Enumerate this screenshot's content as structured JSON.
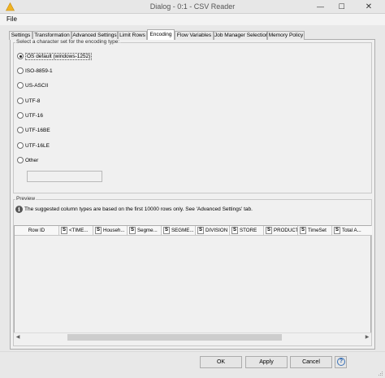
{
  "window": {
    "title": "Dialog - 0:1 - CSV Reader",
    "minimize_glyph": "—",
    "maximize_glyph": "☐",
    "close_glyph": "✕"
  },
  "menu": {
    "file": "File"
  },
  "tabs": [
    {
      "label": "Settings",
      "active": false
    },
    {
      "label": "Transformation",
      "active": false
    },
    {
      "label": "Advanced Settings",
      "active": false
    },
    {
      "label": "Limit Rows",
      "active": false
    },
    {
      "label": "Encoding",
      "active": true
    },
    {
      "label": "Flow Variables",
      "active": false
    },
    {
      "label": "Job Manager Selection",
      "active": false
    },
    {
      "label": "Memory Policy",
      "active": false
    }
  ],
  "encoding": {
    "group_label": "Select a character set for the encoding type:",
    "options": [
      {
        "label": "OS default (windows-1252)",
        "selected": true
      },
      {
        "label": "ISO-8859-1",
        "selected": false
      },
      {
        "label": "US-ASCII",
        "selected": false
      },
      {
        "label": "UTF-8",
        "selected": false
      },
      {
        "label": "UTF-16",
        "selected": false
      },
      {
        "label": "UTF-16BE",
        "selected": false
      },
      {
        "label": "UTF-16LE",
        "selected": false
      },
      {
        "label": "Other",
        "selected": false
      }
    ],
    "other_value": ""
  },
  "preview": {
    "group_label": "Preview",
    "info_glyph": "i",
    "info_text": "The suggested column types are based on the first 10000 rows only. See 'Advanced Settings' tab.",
    "type_glyph": "S",
    "row_id_header": "Row ID",
    "columns": [
      "<TIME...",
      "Househ...",
      "Segme...",
      "SEGME...",
      "DIVISION",
      "STORE",
      "PRODUCT",
      "TimeSet",
      "Total A..."
    ]
  },
  "scroll": {
    "left_glyph": "◀",
    "right_glyph": "▶"
  },
  "buttons": {
    "ok": "OK",
    "apply": "Apply",
    "cancel": "Cancel",
    "help_glyph": "?"
  },
  "colors": {
    "accent": "#3a72b8",
    "app_icon": "#f0b323"
  }
}
